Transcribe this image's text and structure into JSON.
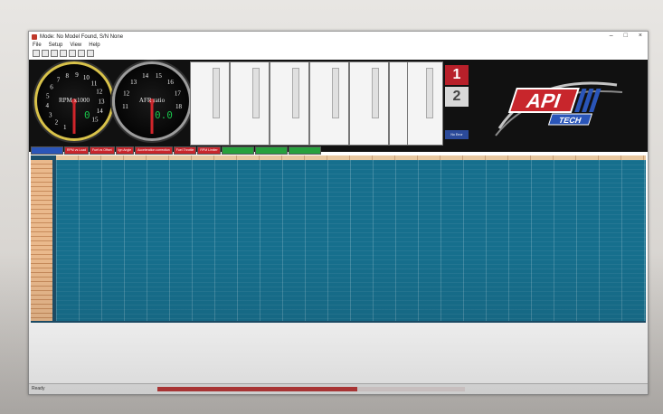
{
  "window": {
    "title": "Mode: No Model Found, S/N None",
    "controls": [
      "–",
      "□",
      "×"
    ]
  },
  "menu": [
    "File",
    "Setup",
    "View",
    "Help"
  ],
  "toolbar": {
    "icon_count": 7
  },
  "gauges": {
    "rpm": {
      "label": "RPM x1000",
      "ticks": [
        "1",
        "2",
        "3",
        "4",
        "5",
        "6",
        "7",
        "8",
        "9",
        "10",
        "11",
        "12",
        "13",
        "14",
        "15"
      ],
      "value": "0"
    },
    "afr": {
      "label": "AFR ratio",
      "ticks": [
        "11",
        "12",
        "13",
        "14",
        "15",
        "16",
        "17",
        "18"
      ],
      "value": "0.0"
    }
  },
  "gear": {
    "top": "1",
    "bottom": "2",
    "error": "No Error"
  },
  "logo": {
    "brand": "API",
    "sub": "TECH"
  },
  "tabs": [
    {
      "label": "",
      "color": "#2a55b8"
    },
    {
      "label": "RPM vs Load",
      "color": "#c8262c"
    },
    {
      "label": "Fuel vs Offset",
      "color": "#c8262c"
    },
    {
      "label": "Ign Angle",
      "color": "#c8262c"
    },
    {
      "label": "Acceleration correction",
      "color": "#c8262c"
    },
    {
      "label": "Fuel Throttle",
      "color": "#c8262c"
    },
    {
      "label": "RPM Limiter",
      "color": "#c8262c"
    },
    {
      "label": "",
      "color": "#27a13d"
    },
    {
      "label": "",
      "color": "#27a13d"
    },
    {
      "label": "",
      "color": "#27a13d"
    }
  ],
  "status": {
    "text": "Ready",
    "progress_fraction": 0.65
  }
}
